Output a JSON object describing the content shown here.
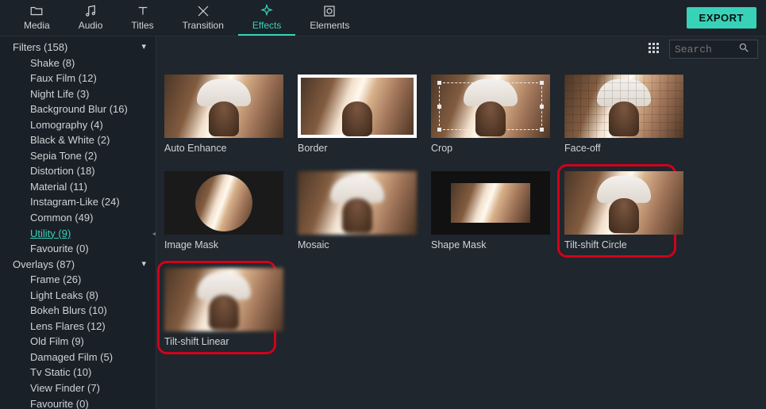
{
  "topnav": {
    "items": [
      {
        "label": "Media"
      },
      {
        "label": "Audio"
      },
      {
        "label": "Titles"
      },
      {
        "label": "Transition"
      },
      {
        "label": "Effects"
      },
      {
        "label": "Elements"
      }
    ],
    "active_index": 4,
    "export_label": "EXPORT"
  },
  "search": {
    "placeholder": "Search"
  },
  "sidebar": {
    "groups": [
      {
        "label": "Filters (158)",
        "expanded": true,
        "children": [
          {
            "label": "Shake (8)"
          },
          {
            "label": "Faux Film (12)"
          },
          {
            "label": "Night Life (3)"
          },
          {
            "label": "Background Blur (16)"
          },
          {
            "label": "Lomography (4)"
          },
          {
            "label": "Black & White (2)"
          },
          {
            "label": "Sepia Tone (2)"
          },
          {
            "label": "Distortion (18)"
          },
          {
            "label": "Material (11)"
          },
          {
            "label": "Instagram-Like (24)"
          },
          {
            "label": "Common (49)"
          },
          {
            "label": "Utility (9)",
            "selected": true
          },
          {
            "label": "Favourite (0)"
          }
        ]
      },
      {
        "label": "Overlays (87)",
        "expanded": true,
        "children": [
          {
            "label": "Frame (26)"
          },
          {
            "label": "Light Leaks (8)"
          },
          {
            "label": "Bokeh Blurs (10)"
          },
          {
            "label": "Lens Flares (12)"
          },
          {
            "label": "Old Film (9)"
          },
          {
            "label": "Damaged Film (5)"
          },
          {
            "label": "Tv Static (10)"
          },
          {
            "label": "View Finder (7)"
          },
          {
            "label": "Favourite (0)"
          }
        ]
      }
    ]
  },
  "effects": {
    "items": [
      {
        "label": "Auto Enhance",
        "kind": "plain"
      },
      {
        "label": "Border",
        "kind": "border"
      },
      {
        "label": "Crop",
        "kind": "crop"
      },
      {
        "label": "Face-off",
        "kind": "pixelate"
      },
      {
        "label": "Image Mask",
        "kind": "mask-circle"
      },
      {
        "label": "Mosaic",
        "kind": "blur"
      },
      {
        "label": "Shape Mask",
        "kind": "shape-mask"
      },
      {
        "label": "Tilt-shift Circle",
        "kind": "plain",
        "highlighted": true
      },
      {
        "label": "Tilt-shift Linear",
        "kind": "blur",
        "highlighted": true
      }
    ]
  }
}
